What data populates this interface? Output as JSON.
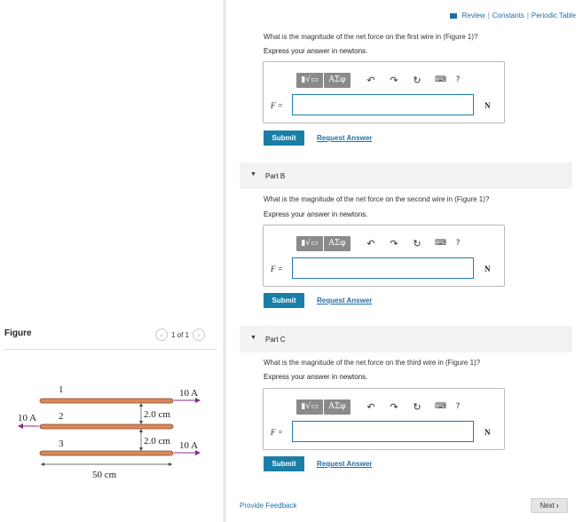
{
  "topbar": {
    "review": "Review",
    "constants": "Constants",
    "periodic": "Periodic Table",
    "sep": "|"
  },
  "parts": [
    {
      "question": "What is the magnitude of the net force on the first wire in (Figure 1)?",
      "express": "Express your answer in newtons.",
      "var": "F =",
      "unit": "N",
      "value": ""
    },
    {
      "title": "Part B",
      "question": "What is the magnitude of the net force on the second wire in (Figure 1)?",
      "express": "Express your answer in newtons.",
      "var": "F =",
      "unit": "N",
      "value": ""
    },
    {
      "title": "Part C",
      "question": "What is the magnitude of the net force on the third wire in (Figure 1)?",
      "express": "Express your answer in newtons.",
      "var": "F =",
      "unit": "N",
      "value": ""
    }
  ],
  "toolbar": {
    "templates": "▮√▭",
    "greek": "ΑΣφ",
    "help": "?"
  },
  "buttons": {
    "submit": "Submit",
    "request": "Request Answer",
    "next": "Next",
    "feedback": "Provide Feedback"
  },
  "figure": {
    "label": "Figure",
    "pager": "1 of 1",
    "wire_labels": [
      "1",
      "2",
      "3"
    ],
    "current_top": "10 A",
    "current_mid": "10 A",
    "current_bot": "10 A",
    "gap1": "2.0 cm",
    "gap2": "2.0 cm",
    "length": "50 cm"
  },
  "colors": {
    "accent": "#1a7ea7",
    "wire": "#d9885a",
    "arrow": "#8a2a8f"
  }
}
